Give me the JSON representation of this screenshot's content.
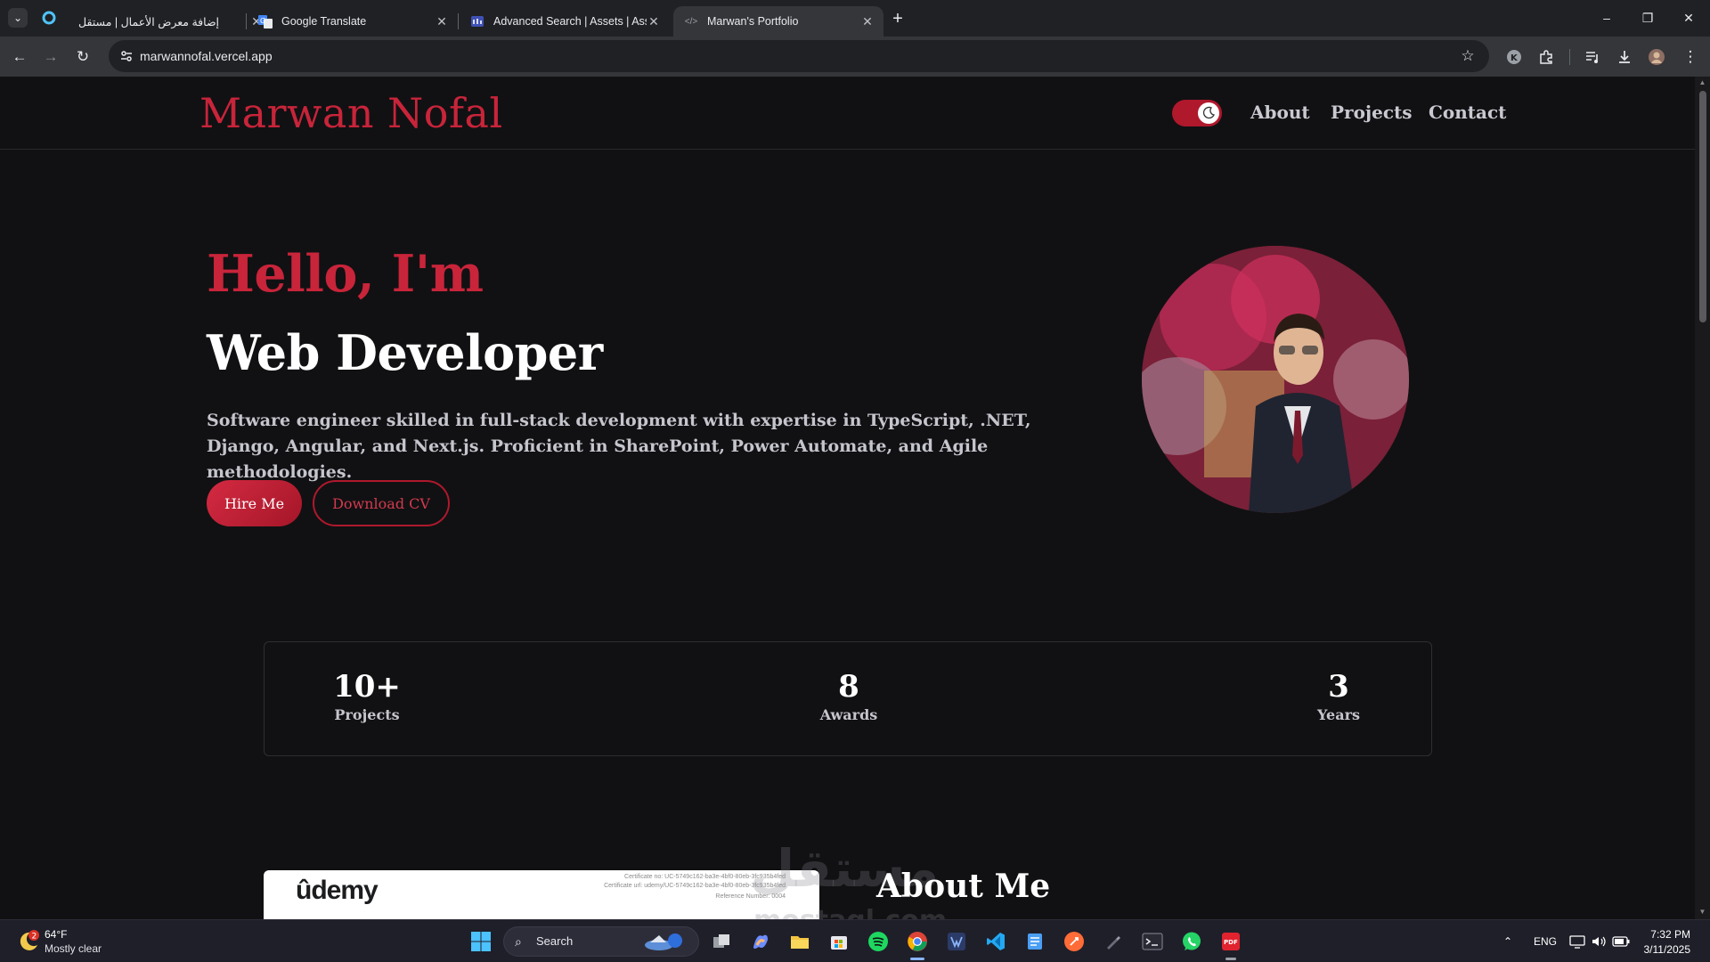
{
  "browser": {
    "tabs": [
      {
        "title": "إضافة معرض الأعمال | مستقل",
        "active": false
      },
      {
        "title": "Google Translate",
        "active": false
      },
      {
        "title": "Advanced Search | Assets | Asse",
        "active": false
      },
      {
        "title": "Marwan's Portfolio",
        "active": true
      }
    ],
    "url": "marwannofal.vercel.app"
  },
  "site": {
    "brand": "Marwan Nofal",
    "nav": [
      "About",
      "Projects",
      "Contact"
    ],
    "hero": {
      "greeting": "Hello, I'm",
      "role": "Web Developer",
      "intro": "Software engineer skilled in full-stack development with expertise in TypeScript, .NET, Django, Angular, and Next.js. Proficient in SharePoint, Power Automate, and Agile methodologies.",
      "hire_label": "Hire Me",
      "cv_label": "Download CV"
    },
    "stats": [
      {
        "value": "10+",
        "label": "Projects"
      },
      {
        "value": "8",
        "label": "Awards"
      },
      {
        "value": "3",
        "label": "Years"
      }
    ],
    "certificate": {
      "logo": "ûdemy",
      "line1": "Certificate no: UC-5749c162-ba3e-4bf0-80eb-3fc935b4fed",
      "line2": "Certificate url: udemy/UC-5749c162-ba3e-4bf0-80eb-3fc935b4fed",
      "line3": "Reference Number: 0004"
    },
    "about_title": "About Me",
    "watermark": "مستقل",
    "watermark_sub": "mostaql.com"
  },
  "taskbar": {
    "weather_temp": "64°F",
    "weather_desc": "Mostly clear",
    "weather_badge": "2",
    "search_label": "Search",
    "lang": "ENG",
    "time": "7:32 PM",
    "date": "3/11/2025"
  },
  "colors": {
    "accent": "#c8243a",
    "page_bg": "#111113",
    "chrome_bg": "#202124"
  }
}
